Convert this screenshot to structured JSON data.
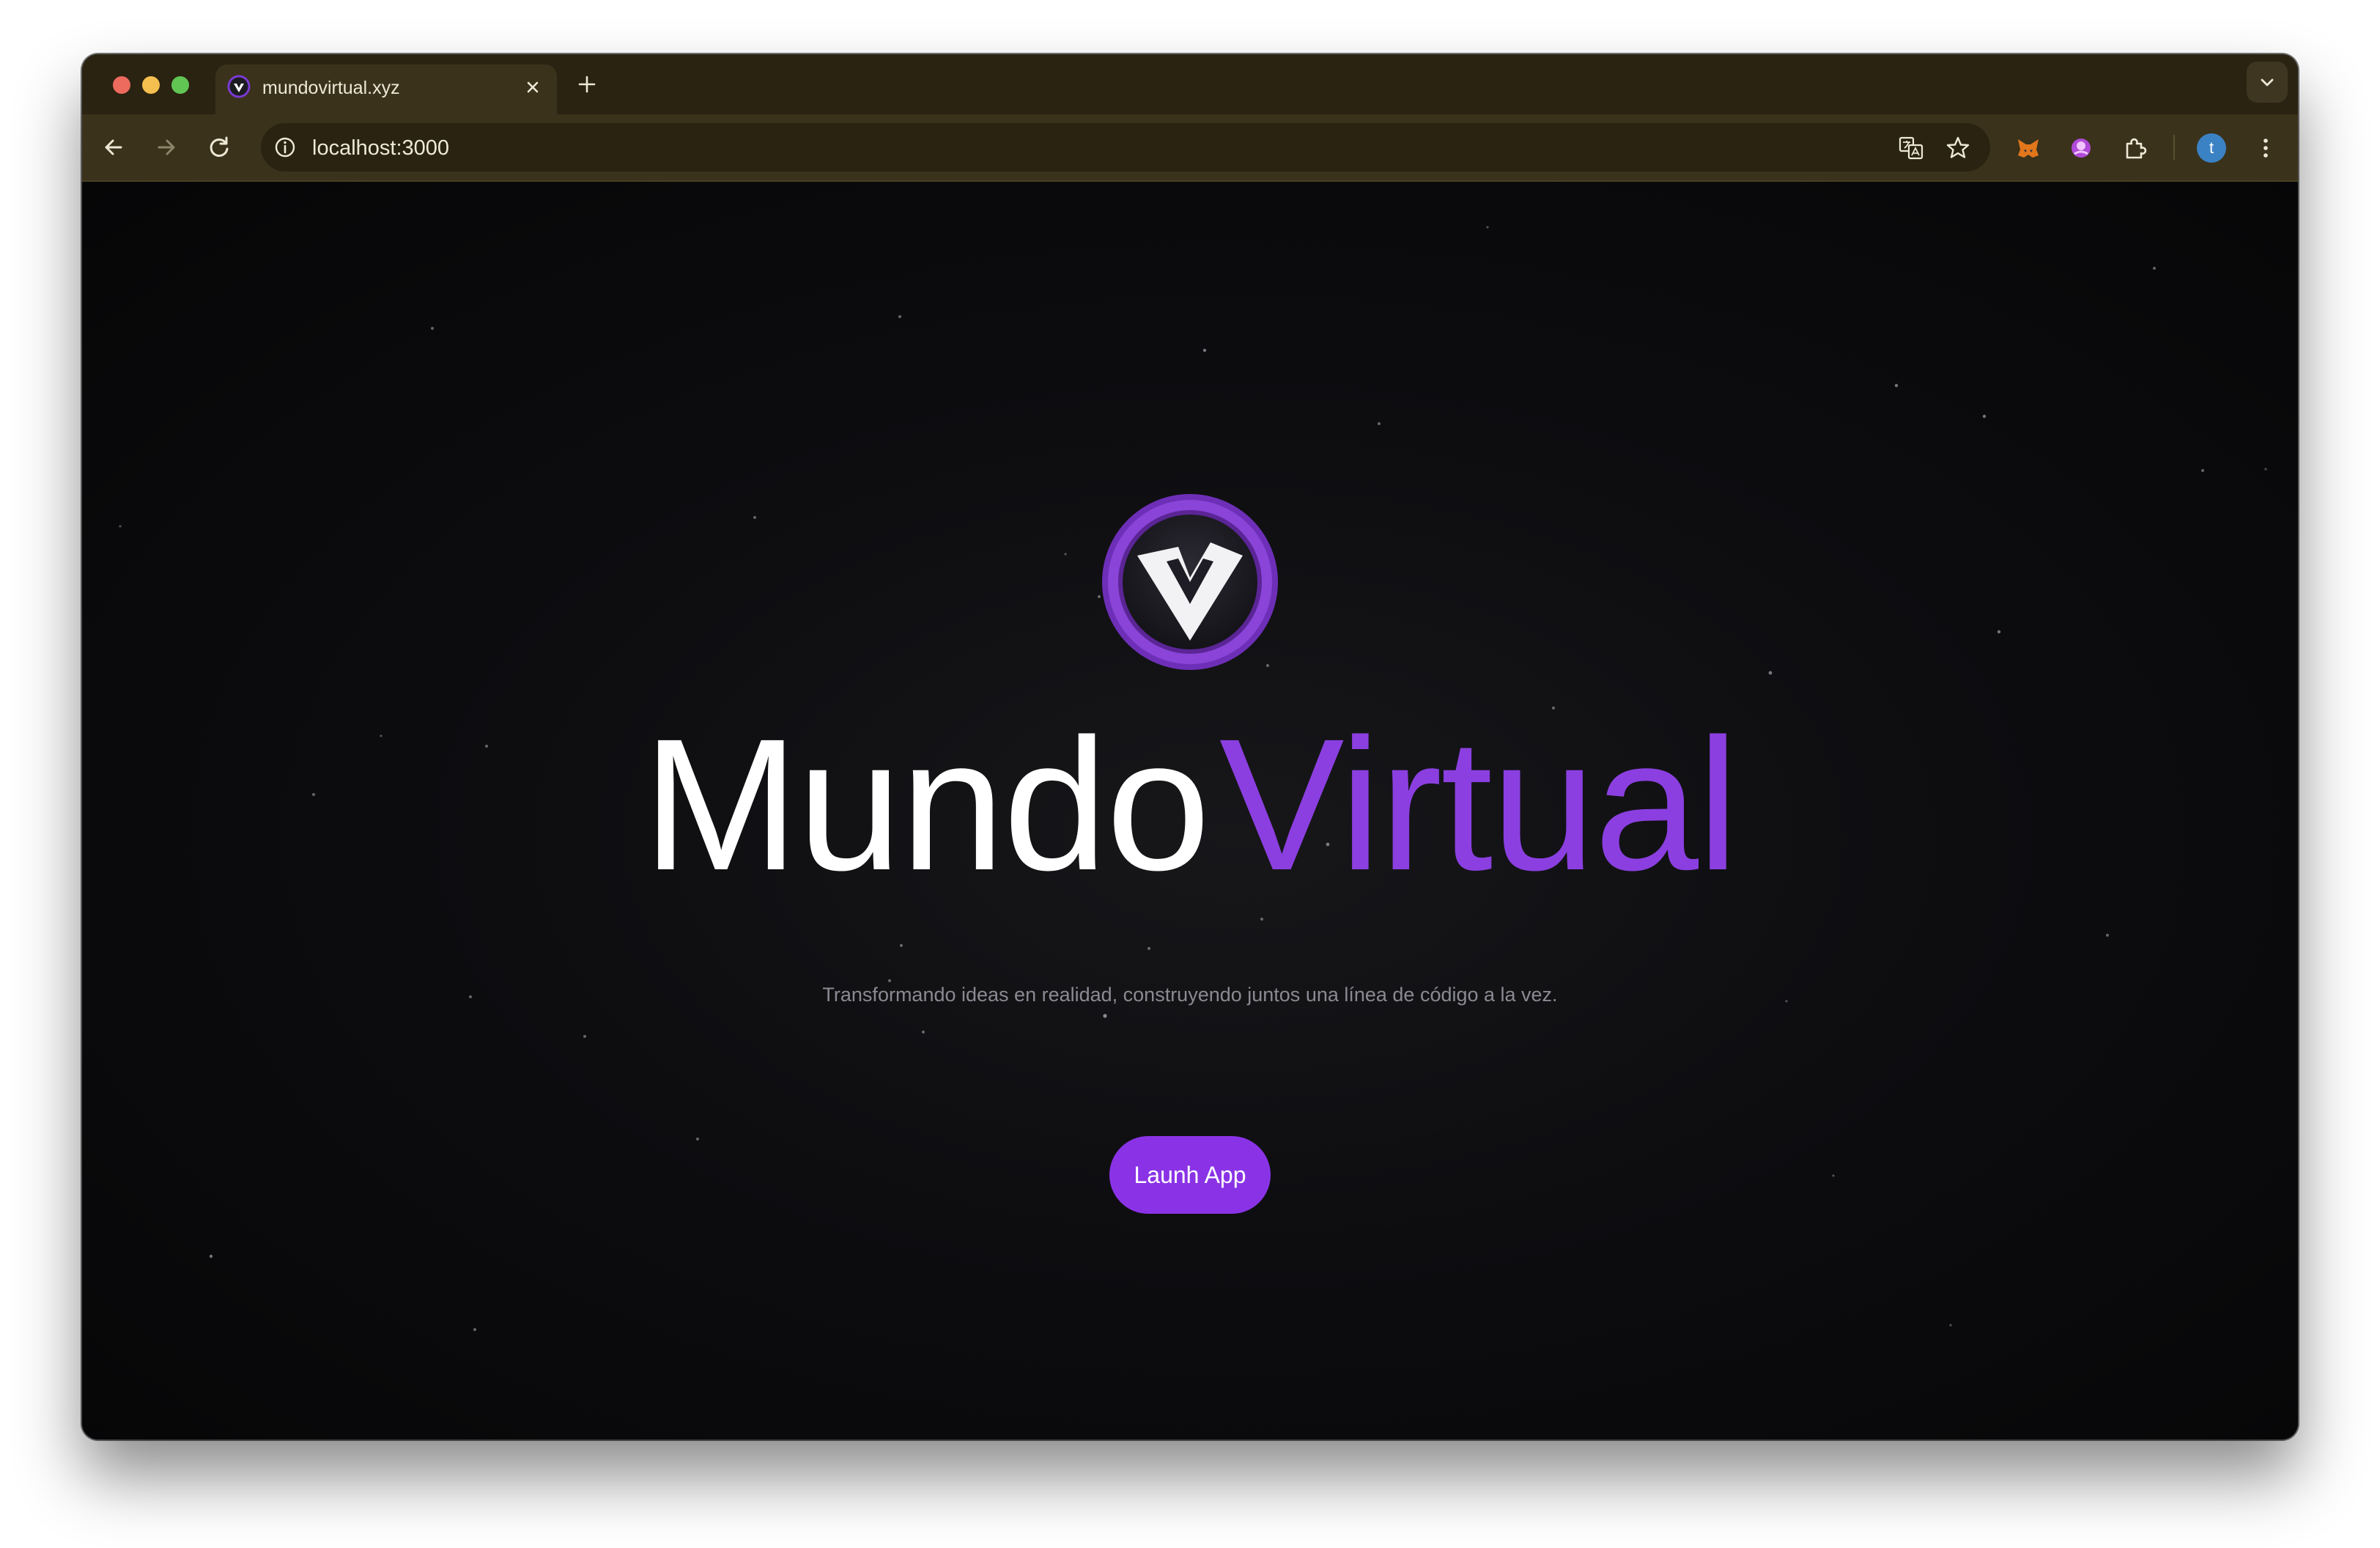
{
  "browser": {
    "tab": {
      "title": "mundovirtual.xyz",
      "favicon": "mundovirtual-logo-icon"
    },
    "address_bar": {
      "url": "localhost:3000"
    },
    "avatar_letter": "t"
  },
  "hero": {
    "title_part1": "Mundo",
    "title_part2": "Virtual",
    "subtitle": "Transformando ideas en realidad, construyendo juntos una línea de código a la vez.",
    "cta_label": "Launh App"
  },
  "colors": {
    "accent": "#8a33e6",
    "title_accent": "#8b3fe0",
    "browser_frame": "#3a321b",
    "page_background": "#0d0d10"
  }
}
